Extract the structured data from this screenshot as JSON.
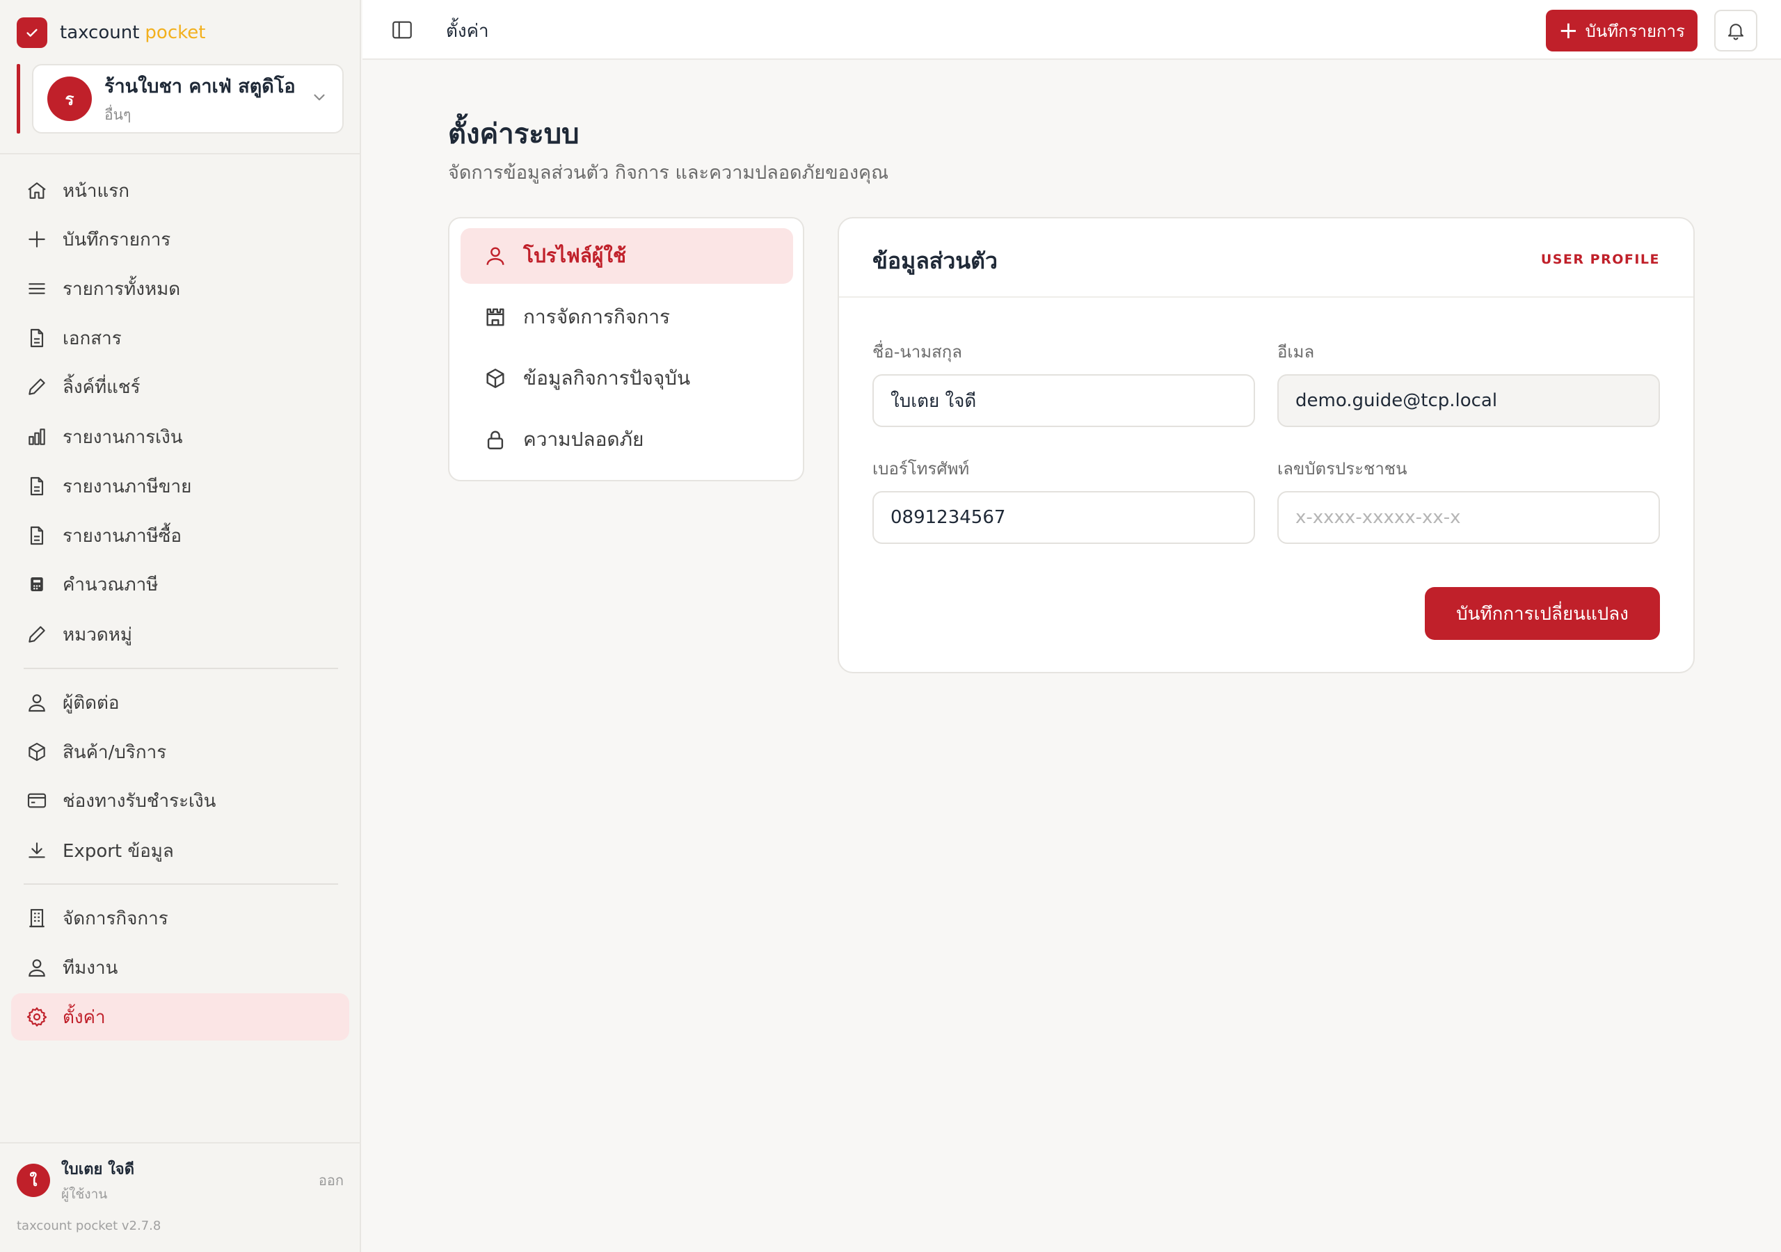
{
  "brand": {
    "name": "taxcount",
    "accent": "pocket",
    "color": "#c0202a",
    "accent_color": "#f2b01e"
  },
  "business": {
    "avatar": "ร",
    "name": "ร้านใบชา คาเฟ่ สตูดิโอ",
    "type": "อื่นๆ"
  },
  "sidebar": {
    "items": [
      {
        "label": "หน้าแรก",
        "icon": "home-icon"
      },
      {
        "label": "บันทึกรายการ",
        "icon": "plus-icon"
      },
      {
        "label": "รายการทั้งหมด",
        "icon": "list-icon"
      },
      {
        "label": "เอกสาร",
        "icon": "document-icon"
      },
      {
        "label": "ลิ้งค์ที่แชร์",
        "icon": "pencil-icon"
      },
      {
        "label": "รายงานการเงิน",
        "icon": "bar-chart-icon"
      },
      {
        "label": "รายงานภาษีขาย",
        "icon": "document-icon"
      },
      {
        "label": "รายงานภาษีซื้อ",
        "icon": "document-icon"
      },
      {
        "label": "คำนวณภาษี",
        "icon": "calculator-icon"
      },
      {
        "label": "หมวดหมู่",
        "icon": "pencil-icon"
      },
      {
        "label": "ผู้ติดต่อ",
        "icon": "user-icon"
      },
      {
        "label": "สินค้า/บริการ",
        "icon": "box-icon"
      },
      {
        "label": "ช่องทางรับชำระเงิน",
        "icon": "credit-card-icon"
      },
      {
        "label": "Export ข้อมูล",
        "icon": "download-icon"
      },
      {
        "label": "จัดการกิจการ",
        "icon": "building-icon"
      },
      {
        "label": "ทีมงาน",
        "icon": "user-icon"
      },
      {
        "label": "ตั้งค่า",
        "icon": "gear-icon"
      }
    ],
    "active": "ตั้งค่า"
  },
  "user": {
    "avatar": "ใ",
    "name": "ใบเตย ใจดี",
    "role": "ผู้ใช้งาน",
    "logout": "ออก"
  },
  "version": "taxcount pocket v2.7.8",
  "topbar": {
    "breadcrumb": "ตั้งค่า",
    "add_label": "บันทึกรายการ"
  },
  "page": {
    "title": "ตั้งค่าระบบ",
    "subtitle": "จัดการข้อมูลส่วนตัว กิจการ และความปลอดภัยของคุณ"
  },
  "settings_menu": [
    {
      "label": "โปรไฟล์ผู้ใช้",
      "icon": "user-icon",
      "active": true
    },
    {
      "label": "การจัดการกิจการ",
      "icon": "store-icon",
      "active": false
    },
    {
      "label": "ข้อมูลกิจการปัจจุบัน",
      "icon": "box-icon",
      "active": false
    },
    {
      "label": "ความปลอดภัย",
      "icon": "lock-icon",
      "active": false
    }
  ],
  "profile": {
    "title": "ข้อมูลส่วนตัว",
    "tag": "USER PROFILE",
    "fields": {
      "name": {
        "label": "ชื่อ-นามสกุล",
        "value": "ใบเตย ใจดี"
      },
      "email": {
        "label": "อีเมล",
        "value": "demo.guide@tcp.local"
      },
      "phone": {
        "label": "เบอร์โทรศัพท์",
        "value": "0891234567"
      },
      "citizen_id": {
        "label": "เลขบัตรประชาชน",
        "placeholder": "x-xxxx-xxxxx-xx-x"
      }
    },
    "save_label": "บันทึกการเปลี่ยนแปลง"
  }
}
